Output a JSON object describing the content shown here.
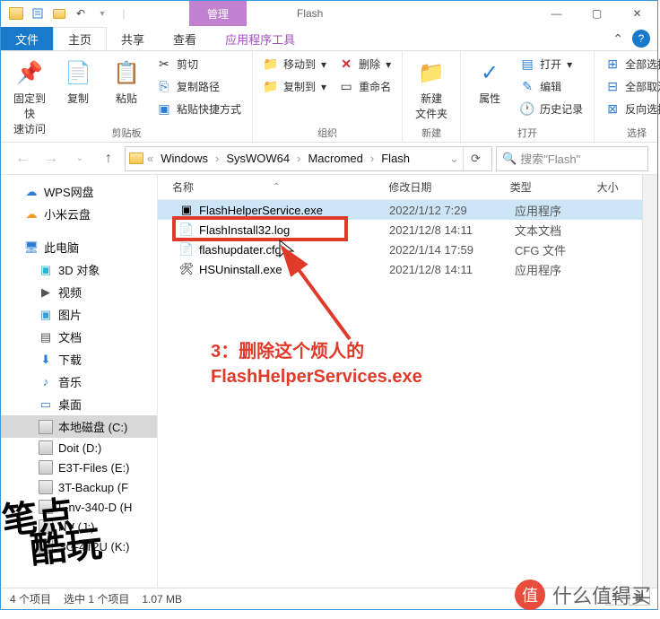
{
  "titlebar": {
    "context_label": "管理",
    "window_title": "Flash",
    "min": "—",
    "max": "▢",
    "close": "✕"
  },
  "tabs": {
    "file": "文件",
    "home": "主页",
    "share": "共享",
    "view": "查看",
    "apptools": "应用程序工具"
  },
  "ribbon": {
    "clipboard": {
      "pin": "固定到快\n速访问",
      "copy": "复制",
      "paste": "粘贴",
      "cut": "剪切",
      "copy_path": "复制路径",
      "paste_shortcut": "粘贴快捷方式",
      "label": "剪贴板"
    },
    "organize": {
      "move_to": "移动到",
      "copy_to": "复制到",
      "delete": "删除",
      "rename": "重命名",
      "label": "组织"
    },
    "new": {
      "new_folder": "新建\n文件夹",
      "label": "新建"
    },
    "open": {
      "properties": "属性",
      "open": "打开",
      "edit": "编辑",
      "history": "历史记录",
      "label": "打开"
    },
    "select": {
      "select_all": "全部选择",
      "select_none": "全部取消",
      "invert": "反向选择",
      "label": "选择"
    }
  },
  "address": {
    "crumbs": [
      "Windows",
      "SysWOW64",
      "Macromed",
      "Flash"
    ],
    "search_placeholder": "搜索\"Flash\""
  },
  "sidebar": {
    "items": [
      {
        "icon": "☁",
        "label": "WPS网盘",
        "color": "#2b7cd3"
      },
      {
        "icon": "☁",
        "label": "小米云盘",
        "color": "#f59a23"
      }
    ],
    "this_pc": "此电脑",
    "pc_items": [
      {
        "icon": "▣",
        "label": "3D 对象",
        "color": "#2bb1d3"
      },
      {
        "icon": "▶",
        "label": "视频",
        "color": "#555"
      },
      {
        "icon": "▣",
        "label": "图片",
        "color": "#3aa0d8"
      },
      {
        "icon": "▤",
        "label": "文档",
        "color": "#555"
      },
      {
        "icon": "⬇",
        "label": "下载",
        "color": "#2b7cd3"
      },
      {
        "icon": "♪",
        "label": "音乐",
        "color": "#2b7cd3"
      },
      {
        "icon": "▭",
        "label": "桌面",
        "color": "#2b7cd3"
      }
    ],
    "drives": [
      {
        "label": "本地磁盘 (C:)",
        "sel": true
      },
      {
        "label": "Doit (D:)"
      },
      {
        "label": "E3T-Files (E:)"
      },
      {
        "label": "3T-Backup (F"
      },
      {
        "label": "L-nv-340-D (H"
      },
      {
        "label": "NV (J:)"
      },
      {
        "label": "SG-4T2U (K:)"
      }
    ]
  },
  "columns": {
    "name": "名称",
    "date": "修改日期",
    "type": "类型",
    "size": "大小"
  },
  "files": [
    {
      "name": "FlashHelperService.exe",
      "date": "2022/1/12 7:29",
      "type": "应用程序",
      "icon": "app",
      "sel": true
    },
    {
      "name": "FlashInstall32.log",
      "date": "2021/12/8 14:11",
      "type": "文本文档",
      "icon": "txt"
    },
    {
      "name": "flashupdater.cfg",
      "date": "2022/1/14 17:59",
      "type": "CFG 文件",
      "icon": "cfg"
    },
    {
      "name": "HSUninstall.exe",
      "date": "2021/12/8 14:11",
      "type": "应用程序",
      "icon": "uninst"
    }
  ],
  "status": {
    "count": "4 个项目",
    "selected": "选中 1 个项目",
    "size": "1.07 MB"
  },
  "annotation": {
    "line1": "3：删除这个烦人的",
    "line2": "FlashHelperServices.exe"
  },
  "watermark": {
    "text1": "笔点",
    "text2": "酷玩",
    "logo_text": "什么值得买",
    "badge": "值"
  }
}
